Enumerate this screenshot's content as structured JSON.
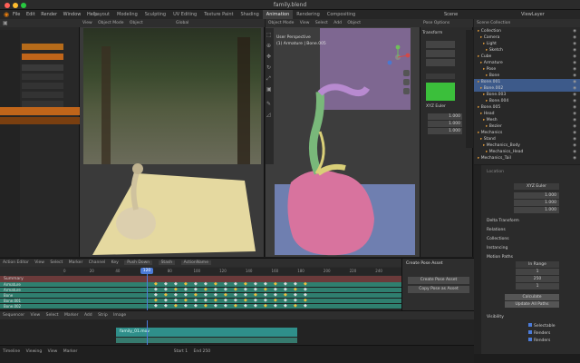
{
  "window": {
    "title": "family.blend"
  },
  "topbar": {
    "menus": [
      "File",
      "Edit",
      "Render",
      "Window",
      "Help"
    ],
    "tabs": [
      "Layout",
      "Modeling",
      "Sculpting",
      "UV Editing",
      "Texture Paint",
      "Shading",
      "Animation",
      "Rendering",
      "Compositing"
    ],
    "active_tab": "Animation",
    "scene_label": "Scene",
    "viewlayer_label": "ViewLayer"
  },
  "left_panel": {
    "items": [
      "",
      "",
      "",
      "",
      "",
      ""
    ],
    "orange_rows": [
      1,
      7
    ]
  },
  "camera_view": {
    "header": [
      "View",
      "View",
      "Object"
    ],
    "mode": "Object Mode",
    "shading": "Global"
  },
  "viewport": {
    "header_mode": "Object Mode",
    "menus": [
      "View",
      "Select",
      "Add",
      "Object"
    ],
    "info_line1": "User Perspective",
    "info_line2": "(1) Armature | Bone.005",
    "overlay_label": "Pose Options",
    "n_panel": {
      "title": "Transform",
      "mode_label": "XYZ Euler",
      "values": [
        "1.000",
        "1.000",
        "1.000"
      ]
    }
  },
  "outliner": {
    "title": "Scene Collection",
    "rows": [
      "Collection",
      "Camera",
      "Light",
      "Sketch",
      "Cube",
      "Armature",
      "Pose",
      "Bone",
      "Bone.001",
      "Bone.002",
      "Bone.003",
      "Bone.004",
      "Bone.005",
      "Head",
      "Mesh",
      "Bezier",
      "Mechanics",
      "Stand",
      "Mechanics_Body",
      "Mechanics_Head",
      "Mechanics_Tail"
    ],
    "selected_rows": [
      8,
      9
    ]
  },
  "properties": {
    "rows": [
      "Location",
      "Rotation",
      "Mode",
      "Scale",
      "Delta Transform",
      "Relations",
      "Collections",
      "Instancing",
      "Motion Paths",
      "Visibility",
      "Viewport Display"
    ],
    "mode_value": "XYZ Euler",
    "values": [
      "1.000",
      "1.000",
      "1.000"
    ],
    "path_type": "In Range",
    "frame_range_start": "1",
    "frame_range_end": "250",
    "step": "1",
    "calculate_label": "Calculate",
    "update_label": "Update All Paths",
    "visible_label": "Visibility",
    "checks": [
      "Selectable",
      "Renders",
      "Renders"
    ]
  },
  "timeline_left": {
    "mode": "Action Editor",
    "menus": [
      "View",
      "Select",
      "Marker",
      "Channel",
      "Key"
    ],
    "action": "ActionName",
    "push_down": "Push Down",
    "stash": "Stash",
    "summary_label": "Summary",
    "channel_labels": [
      "Armature",
      "Armature",
      "Bone",
      "Bone.001",
      "Bone.002"
    ]
  },
  "frame_numbers": [
    "0",
    "20",
    "40",
    "60",
    "80",
    "100",
    "120",
    "140",
    "160",
    "180",
    "200",
    "220",
    "240"
  ],
  "current_frame": "120",
  "create_pose": {
    "title": "Create Pose Asset",
    "btn1": "Create Pose Asset",
    "btn2": "Copy Pose as Asset"
  },
  "sequencer": {
    "mode": "Sequencer",
    "menus": [
      "View",
      "Select",
      "Marker",
      "Add",
      "Strip",
      "Image"
    ],
    "strip_label": "family_01.mov"
  },
  "statusbar": {
    "items": [
      "Timeline",
      "Viewing",
      "View",
      "Marker"
    ],
    "start": "Start 1",
    "end": "End 250"
  }
}
